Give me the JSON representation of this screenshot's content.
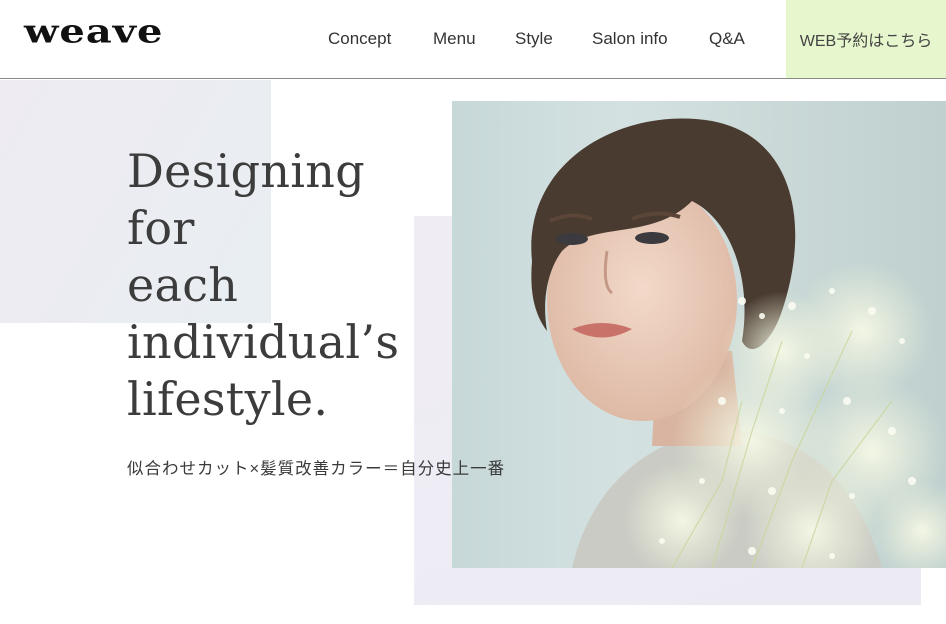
{
  "brand": {
    "logo_text": "weave"
  },
  "nav": {
    "items": [
      {
        "label": "Concept"
      },
      {
        "label": "Menu"
      },
      {
        "label": "Style"
      },
      {
        "label": "Salon info"
      },
      {
        "label": "Q&A"
      }
    ],
    "reserve_label": "WEB予約はこちら"
  },
  "hero": {
    "headline_lines": [
      "Designing",
      "for",
      "each",
      "individual’s",
      "lifestyle."
    ],
    "subtitle": "似合わせカット×髪質改善カラー＝自分史上一番",
    "photo_icon": "portrait-photo"
  },
  "colors": {
    "reserve_bg": "#e6f6cd",
    "accent_block": "#eeebf2",
    "text": "#3a3a3a"
  }
}
